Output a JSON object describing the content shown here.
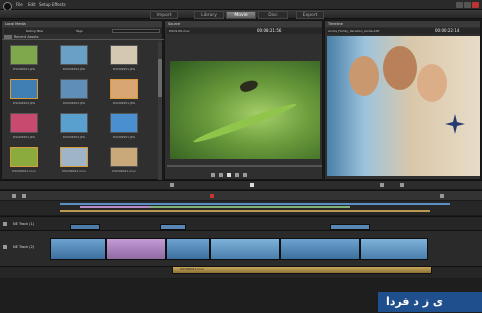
{
  "menu": [
    "File",
    "Edit",
    "Setup",
    "Effects"
  ],
  "tabs": [
    {
      "label": "Import",
      "active": false
    },
    {
      "label": "Library",
      "active": false
    },
    {
      "label": "Movie",
      "active": true
    },
    {
      "label": "Disc",
      "active": false
    },
    {
      "label": "Export",
      "active": false
    }
  ],
  "library": {
    "tree_label": "Local Media",
    "filter_label": "Rating filter",
    "tags_label": "Tags",
    "rating_value": "All",
    "folder_label": "Recent Assets",
    "items": [
      "DSCN0001.JPG",
      "DSCN4952.JPG",
      "DSCN9951.JPG",
      "DSCN4952.JPG",
      "DSCN4952.JPG",
      "DSCN9951.JPG",
      "DSCN4951.JPG",
      "DSCN4952.JPG",
      "DSCN9951.JPG",
      "DSCN9021.mov",
      "DSCN9021.mov",
      "DSCN9021.mov"
    ]
  },
  "source": {
    "header": "Source",
    "filename": "DSC9-PR.mov",
    "timecode": "00:08:21:56"
  },
  "timeline_preview": {
    "header": "Timeline",
    "filename": "Andra_Family_Vacation_Aloha.AXP",
    "timecode": "00:00:22:14"
  },
  "tracks": [
    {
      "name": "NE Track (1)"
    },
    {
      "name": "NE Track (2)"
    }
  ],
  "clip_captions": [
    "DSCN4952.JPG",
    "DSC9.mov",
    "DSCN9021.mov",
    "DSCN9951.mov"
  ],
  "watermark": {
    "text": "ی ز د فردا"
  }
}
